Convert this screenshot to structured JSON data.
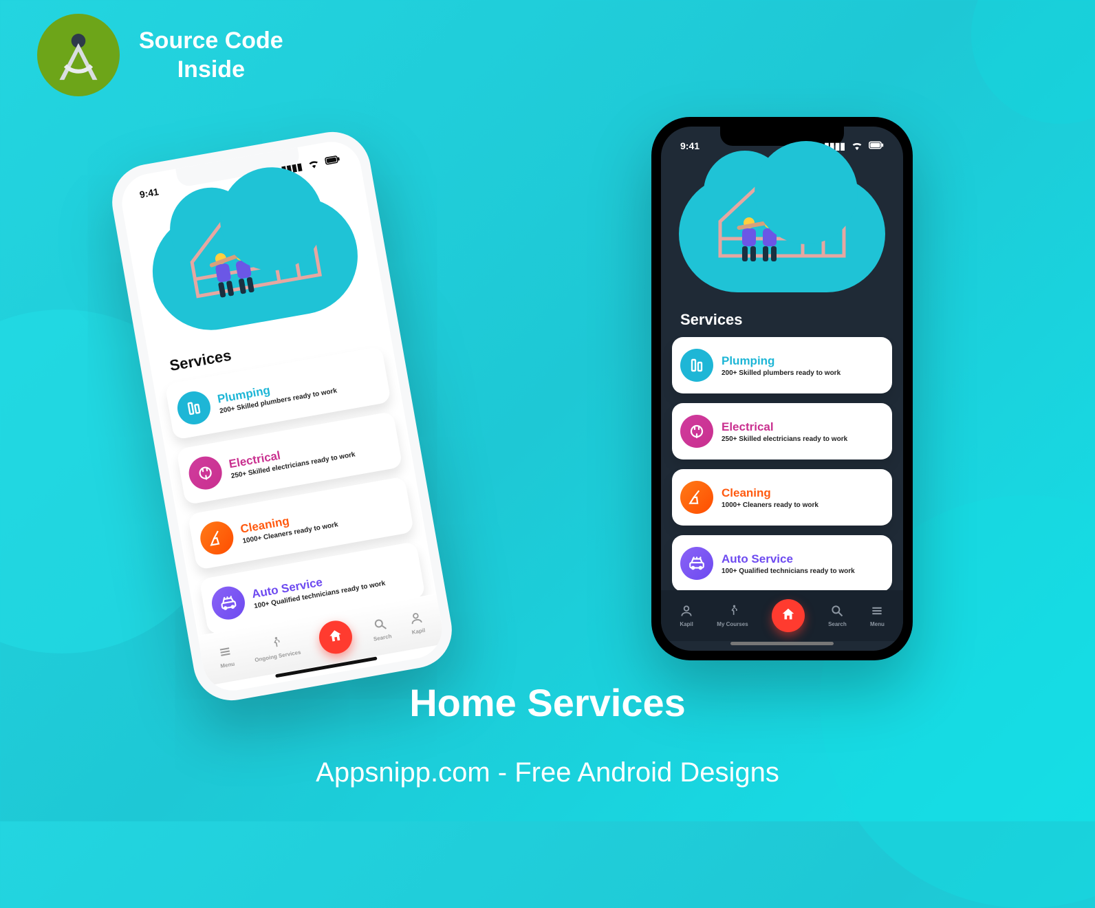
{
  "badge": {
    "line1": "Source Code",
    "line2": "Inside"
  },
  "title": "Home Services",
  "subtitle": "Appsnipp.com - Free Android Designs",
  "status_time": "9:41",
  "section_heading": "Services",
  "services": [
    {
      "title": "Plumping",
      "subtitle": "200+ Skilled plumbers ready to work",
      "icon": "plumbing-icon",
      "color": "blue"
    },
    {
      "title": "Electrical",
      "subtitle": "250+ Skilled electricians ready to work",
      "icon": "plug-icon",
      "color": "pink"
    },
    {
      "title": "Cleaning",
      "subtitle": "1000+ Cleaners ready to work",
      "icon": "broom-icon",
      "color": "orange"
    },
    {
      "title": "Auto Service",
      "subtitle": "100+ Qualified technicians ready to work",
      "icon": "car-icon",
      "color": "violet"
    }
  ],
  "tabs_light": [
    {
      "label": "Menu",
      "icon": "menu-icon"
    },
    {
      "label": "Ongoing Services",
      "icon": "runner-icon"
    },
    {
      "label": "",
      "icon": "home-icon",
      "center": true
    },
    {
      "label": "Search",
      "icon": "search-icon"
    },
    {
      "label": "Kapil",
      "icon": "user-icon"
    }
  ],
  "tabs_dark": [
    {
      "label": "Kapil",
      "icon": "user-icon"
    },
    {
      "label": "My Courses",
      "icon": "runner-icon"
    },
    {
      "label": "",
      "icon": "home-icon",
      "center": true
    },
    {
      "label": "Search",
      "icon": "search-icon"
    },
    {
      "label": "Menu",
      "icon": "menu-icon"
    }
  ]
}
